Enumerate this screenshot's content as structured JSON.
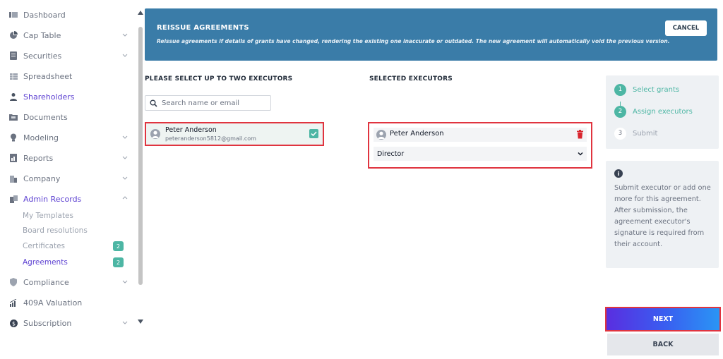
{
  "sidebar": {
    "items": [
      {
        "label": "Dashboard",
        "icon": "dashboard-icon"
      },
      {
        "label": "Cap Table",
        "icon": "pie-chart-icon"
      },
      {
        "label": "Securities",
        "icon": "document-icon"
      },
      {
        "label": "Spreadsheet",
        "icon": "spreadsheet-icon"
      },
      {
        "label": "Shareholders",
        "icon": "person-icon"
      },
      {
        "label": "Documents",
        "icon": "folder-icon"
      },
      {
        "label": "Modeling",
        "icon": "bulb-icon"
      },
      {
        "label": "Reports",
        "icon": "report-icon"
      },
      {
        "label": "Company",
        "icon": "building-icon"
      },
      {
        "label": "Admin Records",
        "icon": "records-icon"
      },
      {
        "label": "Compliance",
        "icon": "shield-icon"
      },
      {
        "label": "409A Valuation",
        "icon": "valuation-icon"
      },
      {
        "label": "Subscription",
        "icon": "dollar-icon"
      }
    ],
    "sub_items": [
      {
        "label": "My Templates"
      },
      {
        "label": "Board resolutions"
      },
      {
        "label": "Certificates",
        "badge": "2"
      },
      {
        "label": "Agreements",
        "badge": "2"
      }
    ]
  },
  "banner": {
    "title": "REISSUE AGREEMENTS",
    "description": "Reissue agreements if details of grants have changed, rendering the existing one inaccurate or outdated. The new agreement will automatically void the previous version.",
    "cancel_label": "CANCEL"
  },
  "executors": {
    "select_label": "PLEASE SELECT UP TO TWO EXECUTORS",
    "search_placeholder": "Search name or email",
    "candidate": {
      "name": "Peter Anderson",
      "email": "peteranderson5812@gmail.com"
    },
    "selected_label": "SELECTED EXECUTORS",
    "selected": {
      "name": "Peter Anderson",
      "role": "Director"
    }
  },
  "steps": [
    {
      "number": "1",
      "label": "Select grants"
    },
    {
      "number": "2",
      "label": "Assign executors"
    },
    {
      "number": "3",
      "label": "Submit"
    }
  ],
  "info": {
    "text": "Submit executor or add one more for this agreement. After submission, the agreement executor's signature is required from their account."
  },
  "actions": {
    "next_label": "NEXT",
    "back_label": "BACK"
  },
  "colors": {
    "accent_purple": "#5b3fd1",
    "teal": "#4db6a4",
    "banner_blue": "#3a7ca8",
    "highlight_red": "#e0343f"
  }
}
